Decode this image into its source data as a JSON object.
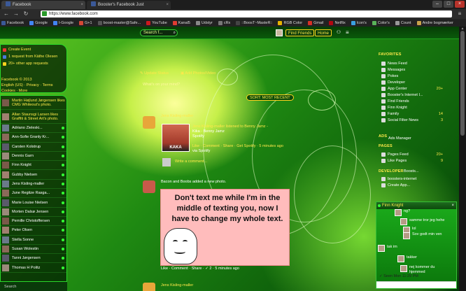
{
  "browser": {
    "tabs": [
      {
        "title": "Facebook"
      },
      {
        "title": "Booster's Facebook Just"
      }
    ],
    "url": "https://www.facebook.com",
    "bookmarks": [
      {
        "label": "Facebook",
        "color": "#3b5998"
      },
      {
        "label": "Google",
        "color": "#4285f4"
      },
      {
        "label": "I-Google",
        "color": "#4285f4"
      },
      {
        "label": "G+1",
        "color": "#d34836"
      },
      {
        "label": "boost-master@Safe...",
        "color": "#555555"
      },
      {
        "label": "YouTube",
        "color": "#cc181e"
      },
      {
        "label": "Kanal5",
        "color": "#e03c31"
      },
      {
        "label": "Udstyr",
        "color": "#888888"
      },
      {
        "label": "cRx",
        "color": "#777777"
      },
      {
        "label": "::BoosT~MasteR::",
        "color": "#444444"
      },
      {
        "label": "RGB Color",
        "color": "#e8b300"
      },
      {
        "label": "Gmail",
        "color": "#d93025"
      },
      {
        "label": "Netflix",
        "color": "#b20710"
      },
      {
        "label": "Icon's",
        "color": "#3aa0e0"
      },
      {
        "label": "Color's",
        "color": "#59b359"
      },
      {
        "label": "Count",
        "color": "#999999"
      },
      {
        "label": "Andre bogmærker",
        "color": "#c9a24a"
      }
    ]
  },
  "fbbar": {
    "search_placeholder": "Search f...",
    "find_friends": "Find Friends",
    "home": "Home"
  },
  "left": {
    "create_event": "Create Event",
    "request": "1 request from Käthe Olesen",
    "app_requests": "20+ other app requests",
    "footer_line1": "Facebook © 2013",
    "footer_line2": "English (US) · Privacy · Terms",
    "footer_line3": "Cookies · More"
  },
  "chat_list": {
    "items": [
      {
        "name": "Martin Højlund Jørgensen likes CMG Whiteout's photo.",
        "big": true
      },
      {
        "name": "Allan Staunsgi Larsen likes Graffiti & Street Art's photo.",
        "big": true
      },
      {
        "name": "Adriano Zieleski..."
      },
      {
        "name": "Ann-Sofie Granly Kr..."
      },
      {
        "name": "Carsten Kolstrup"
      },
      {
        "name": "Dennis Garn"
      },
      {
        "name": "Finn Knight"
      },
      {
        "name": "Gubby Nielsen"
      },
      {
        "name": "Jens Kisling-maller"
      },
      {
        "name": "June Regitze Rasga..."
      },
      {
        "name": "Marie Louise Nielsen"
      },
      {
        "name": "Morten Dalsø Jensen"
      },
      {
        "name": "Pernille Christoffersen"
      },
      {
        "name": "Peter Olsen"
      },
      {
        "name": "Stella Sonne"
      },
      {
        "name": "Susan Wolestin"
      },
      {
        "name": "Tanni Jørgensen"
      },
      {
        "name": "Thomas H Politz"
      }
    ],
    "search_label": "Search"
  },
  "feed": {
    "update_status": "Update Status",
    "add_photos": "Add Photos/Video",
    "whats_on_mind": "What's on your mind?",
    "sort": "SORT: MOST RECENT",
    "post1_author": "Jens Kisling-maller",
    "post1_line1": "Jens Kisling-maller listened to Benny Jamz -",
    "post1_line2": "Kika · Benny Jamz",
    "post1_line3": "Spotify",
    "post1_actions": "Like · Comment · Share · Get Spotify · 5 minutes ago",
    "post1_via": "via Spotify",
    "album_caption": "KAKA",
    "write_comment": "Write a comment...",
    "post2_title": "Bacon and Boobs added a new photo.",
    "meme_text": "Don't text me while I'm in the middle of texting you, now I have to change my whole text.",
    "post2_actions": "Like · Comment · Share · ✓ 2 · 5 minutes ago",
    "post3_author": "Jens Kisling-maller"
  },
  "right": {
    "favorites": "FAVORITES",
    "fav_items": [
      {
        "label": "News Feed",
        "count": ""
      },
      {
        "label": "Messages",
        "count": ""
      },
      {
        "label": "Pokes",
        "count": ""
      },
      {
        "label": "Developer",
        "count": ""
      },
      {
        "label": "App Center",
        "count": "20+"
      },
      {
        "label": "Booster's Internet I...",
        "count": ""
      },
      {
        "label": "Find Friends",
        "count": ""
      },
      {
        "label": "Finn Knight",
        "count": ""
      },
      {
        "label": "Family",
        "count": "14"
      },
      {
        "label": "Social Filter News",
        "count": "3"
      }
    ],
    "ads": "ADS",
    "ads_manager": "Ads Manager",
    "pages": "PAGES",
    "pages_items": [
      {
        "label": "Pages Feed",
        "count": "20+"
      },
      {
        "label": "Like Pages",
        "count": "9"
      }
    ],
    "developer": "DEVELOPER",
    "dev_items": [
      {
        "label": "boosters-internet",
        "count": ""
      },
      {
        "label": "Create App...",
        "count": ""
      }
    ],
    "dev_extra": "Boosts..."
  },
  "chat": {
    "name": "Finn Knight",
    "messages": [
      {
        "text": "ng?"
      },
      {
        "text": "samme tror jeg hehe"
      },
      {
        "text": "lol"
      },
      {
        "text": "Sov godt min ven"
      },
      {
        "text": "tak im"
      },
      {
        "text": "takker"
      },
      {
        "text": "nej kommer du hjemmed"
      }
    ],
    "seen": "Seen Mon 11:29 PM"
  }
}
